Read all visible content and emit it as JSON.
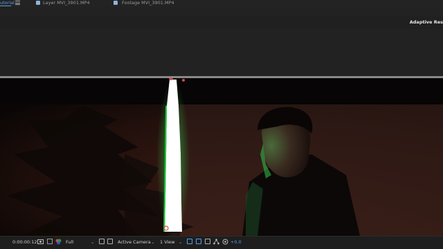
{
  "tabs": {
    "active_label": "utorial",
    "layer_label": "Layer  MVI_3901.MP4",
    "footage_label": "Footage  MVI_3901.MP4"
  },
  "header": {
    "adaptive_label": "Adaptive Res"
  },
  "bottom_bar": {
    "timecode": "0:00:00:12",
    "resolution": "Full",
    "camera": "Active Camera",
    "views": "1 View",
    "exposure": "+0.0"
  },
  "colors": {
    "accent": "#5aa0e8",
    "green_rim": "#19c83a",
    "red_wash": "#3a1410",
    "light_saber": "#ffffff",
    "mask_point": "#d04a4a"
  },
  "icons": [
    "menu-icon",
    "snapshot-icon",
    "color-wheel-icon",
    "region-icon",
    "transparency-grid-icon",
    "mask-toggle-icon",
    "fast-preview-icon",
    "channel-icon",
    "flowchart-icon",
    "exposure-icon"
  ]
}
